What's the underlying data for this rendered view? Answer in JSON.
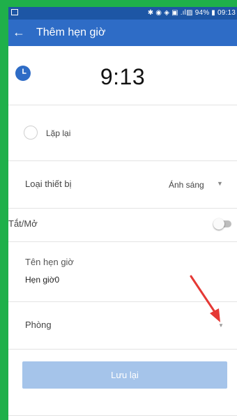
{
  "status_bar": {
    "right_text": "✱ ◉ ◈ ▣ .ıl▨ 94% ▮ 09:13",
    "battery": "94%",
    "time": "09:13"
  },
  "appbar": {
    "back_icon": "arrow-back-icon",
    "title": "Thêm hẹn giờ"
  },
  "clock": {
    "icon": "clock-icon",
    "time": "9:13"
  },
  "repeat": {
    "label": "Lặp lại",
    "checked": false
  },
  "device_type": {
    "label": "Loại thiết bị",
    "value": "Ánh sáng",
    "icon": "dropdown-caret-icon"
  },
  "power": {
    "label": "Tắt/Mở",
    "on": false
  },
  "timer_name": {
    "label": "Tên hẹn giờ",
    "value": "Hẹn giờ0"
  },
  "room": {
    "label": "Phòng",
    "icon": "dropdown-caret-icon"
  },
  "save_button": {
    "label": "Lưu lại"
  },
  "colors": {
    "appbar": "#2e6cc6",
    "status_bar": "#1d56a5",
    "button": "#a5c4ea",
    "annotation_arrow": "#e53935",
    "frame": "#1fb04a"
  }
}
